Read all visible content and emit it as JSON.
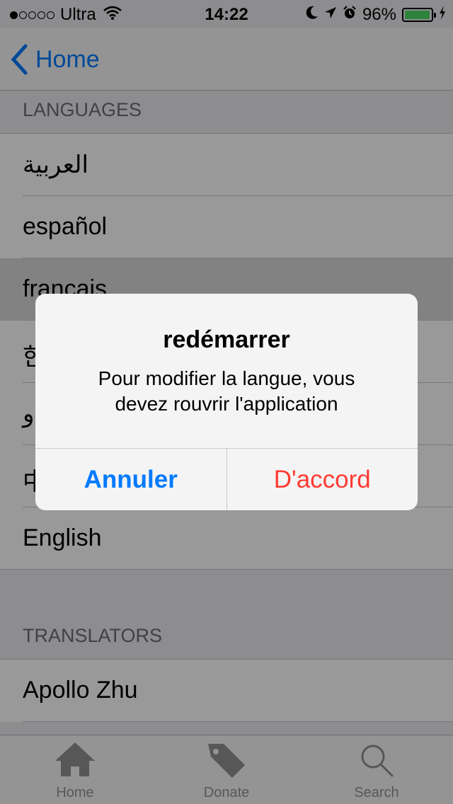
{
  "status_bar": {
    "signal_bars_filled": 1,
    "signal_bars_total": 5,
    "carrier": "Ultra",
    "time": "14:22",
    "battery_percent": "96%",
    "battery_level": 0.96,
    "battery_color": "#4cd964"
  },
  "nav": {
    "back_label": "Home"
  },
  "languages": {
    "header": "LANGUAGES",
    "items": [
      "العربية",
      "español",
      "français",
      "한",
      "و",
      "中",
      "English"
    ],
    "selected_index": 2
  },
  "translators": {
    "header": "TRANSLATORS",
    "items": [
      "Apollo Zhu"
    ]
  },
  "tab_bar": {
    "items": [
      {
        "label": "Home",
        "icon": "home-icon"
      },
      {
        "label": "Donate",
        "icon": "tag-icon"
      },
      {
        "label": "Search",
        "icon": "search-icon"
      }
    ]
  },
  "alert": {
    "title": "redémarrer",
    "message_line1": "Pour modifier la langue, vous",
    "message_line2": "devez rouvrir l'application",
    "cancel_label": "Annuler",
    "ok_label": "D'accord",
    "cancel_color": "#007aff",
    "ok_color": "#ff3b30"
  },
  "colors": {
    "accent": "#007aff",
    "destructive": "#ff3b30"
  }
}
